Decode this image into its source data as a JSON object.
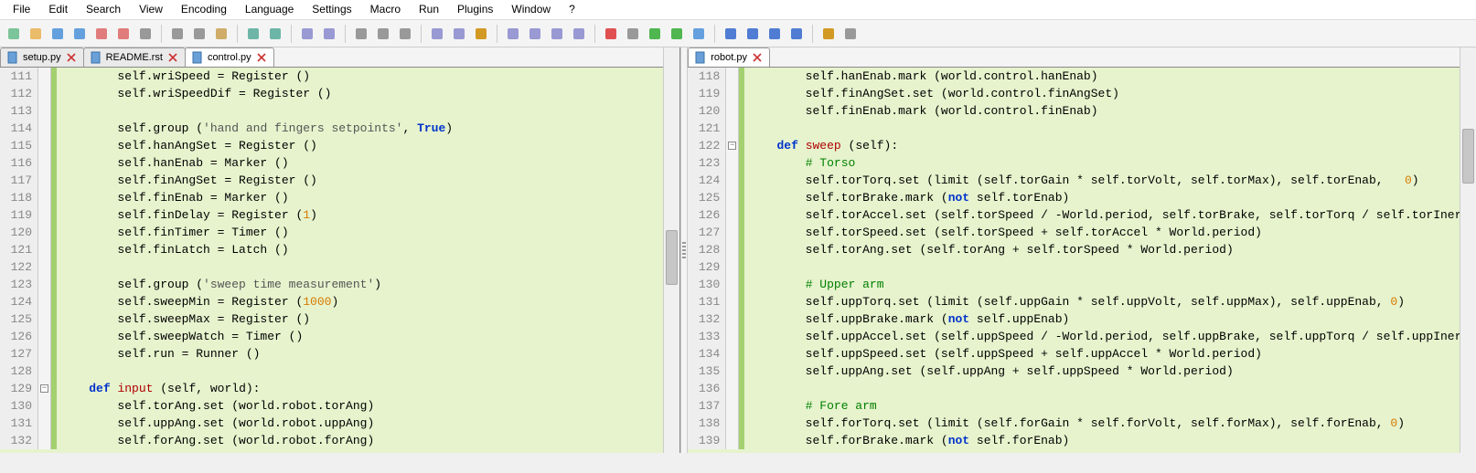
{
  "menu": [
    "File",
    "Edit",
    "Search",
    "View",
    "Encoding",
    "Language",
    "Settings",
    "Macro",
    "Run",
    "Plugins",
    "Window",
    "?"
  ],
  "leftTabs": [
    {
      "label": "setup.py",
      "active": false
    },
    {
      "label": "README.rst",
      "active": false
    },
    {
      "label": "control.py",
      "active": true
    }
  ],
  "rightTabs": [
    {
      "label": "robot.py",
      "active": true
    }
  ],
  "leftLines": [
    {
      "n": 111,
      "segs": [
        {
          "t": "        self.wriSpeed = Register ()"
        }
      ]
    },
    {
      "n": 112,
      "segs": [
        {
          "t": "        self.wriSpeedDif = Register ()"
        }
      ]
    },
    {
      "n": 113,
      "segs": [
        {
          "t": ""
        }
      ]
    },
    {
      "n": 114,
      "segs": [
        {
          "t": "        self.group ("
        },
        {
          "t": "'hand and fingers setpoints'",
          "c": "str"
        },
        {
          "t": ", "
        },
        {
          "t": "True",
          "c": "kw-true"
        },
        {
          "t": ")"
        }
      ]
    },
    {
      "n": 115,
      "segs": [
        {
          "t": "        self.hanAngSet = Register ()"
        }
      ]
    },
    {
      "n": 116,
      "segs": [
        {
          "t": "        self.hanEnab = Marker ()"
        }
      ]
    },
    {
      "n": 117,
      "segs": [
        {
          "t": "        self.finAngSet = Register ()"
        }
      ]
    },
    {
      "n": 118,
      "segs": [
        {
          "t": "        self.finEnab = Marker ()"
        }
      ]
    },
    {
      "n": 119,
      "segs": [
        {
          "t": "        self.finDelay = Register ("
        },
        {
          "t": "1",
          "c": "num"
        },
        {
          "t": ")"
        }
      ]
    },
    {
      "n": 120,
      "segs": [
        {
          "t": "        self.finTimer = Timer ()"
        }
      ]
    },
    {
      "n": 121,
      "segs": [
        {
          "t": "        self.finLatch = Latch ()"
        }
      ]
    },
    {
      "n": 122,
      "segs": [
        {
          "t": ""
        }
      ]
    },
    {
      "n": 123,
      "segs": [
        {
          "t": "        self.group ("
        },
        {
          "t": "'sweep time measurement'",
          "c": "str"
        },
        {
          "t": ")"
        }
      ]
    },
    {
      "n": 124,
      "segs": [
        {
          "t": "        self.sweepMin = Register ("
        },
        {
          "t": "1000",
          "c": "num"
        },
        {
          "t": ")"
        }
      ]
    },
    {
      "n": 125,
      "segs": [
        {
          "t": "        self.sweepMax = Register ()"
        }
      ]
    },
    {
      "n": 126,
      "segs": [
        {
          "t": "        self.sweepWatch = Timer ()"
        }
      ]
    },
    {
      "n": 127,
      "segs": [
        {
          "t": "        self.run = Runner ()"
        }
      ]
    },
    {
      "n": 128,
      "segs": [
        {
          "t": ""
        }
      ]
    },
    {
      "n": 129,
      "fold": "-",
      "segs": [
        {
          "t": "    "
        },
        {
          "t": "def",
          "c": "kw-def"
        },
        {
          "t": " "
        },
        {
          "t": "input",
          "c": "fname"
        },
        {
          "t": " (self, world):"
        }
      ]
    },
    {
      "n": 130,
      "segs": [
        {
          "t": "        self.torAng.set (world.robot.torAng)"
        }
      ]
    },
    {
      "n": 131,
      "segs": [
        {
          "t": "        self.uppAng.set (world.robot.uppAng)"
        }
      ]
    },
    {
      "n": 132,
      "segs": [
        {
          "t": "        self.forAng.set (world.robot.forAng)"
        }
      ]
    }
  ],
  "rightLines": [
    {
      "n": 118,
      "segs": [
        {
          "t": "        self.hanEnab.mark (world.control.hanEnab)"
        }
      ]
    },
    {
      "n": 119,
      "segs": [
        {
          "t": "        self.finAngSet.set (world.control.finAngSet)"
        }
      ]
    },
    {
      "n": 120,
      "segs": [
        {
          "t": "        self.finEnab.mark (world.control.finEnab)"
        }
      ]
    },
    {
      "n": 121,
      "segs": [
        {
          "t": ""
        }
      ]
    },
    {
      "n": 122,
      "fold": "-",
      "segs": [
        {
          "t": "    "
        },
        {
          "t": "def",
          "c": "kw-def"
        },
        {
          "t": " "
        },
        {
          "t": "sweep",
          "c": "fname"
        },
        {
          "t": " (self):"
        }
      ]
    },
    {
      "n": 123,
      "segs": [
        {
          "t": "        "
        },
        {
          "t": "# Torso",
          "c": "cmt"
        }
      ]
    },
    {
      "n": 124,
      "segs": [
        {
          "t": "        self.torTorq.set (limit (self.torGain * self.torVolt, self.torMax), self.torEnab,   "
        },
        {
          "t": "0",
          "c": "num"
        },
        {
          "t": ")"
        }
      ]
    },
    {
      "n": 125,
      "segs": [
        {
          "t": "        self.torBrake.mark ("
        },
        {
          "t": "not",
          "c": "kw-def"
        },
        {
          "t": " self.torEnab)"
        }
      ]
    },
    {
      "n": 126,
      "segs": [
        {
          "t": "        self.torAccel.set (self.torSpeed / -World.period, self.torBrake, self.torTorq / self.torInert)"
        }
      ]
    },
    {
      "n": 127,
      "segs": [
        {
          "t": "        self.torSpeed.set (self.torSpeed + self.torAccel * World.period)"
        }
      ]
    },
    {
      "n": 128,
      "segs": [
        {
          "t": "        self.torAng.set (self.torAng + self.torSpeed * World.period)"
        }
      ]
    },
    {
      "n": 129,
      "segs": [
        {
          "t": ""
        }
      ]
    },
    {
      "n": 130,
      "segs": [
        {
          "t": "        "
        },
        {
          "t": "# Upper arm",
          "c": "cmt"
        }
      ]
    },
    {
      "n": 131,
      "segs": [
        {
          "t": "        self.uppTorq.set (limit (self.uppGain * self.uppVolt, self.uppMax), self.uppEnab, "
        },
        {
          "t": "0",
          "c": "num"
        },
        {
          "t": ")"
        }
      ]
    },
    {
      "n": 132,
      "segs": [
        {
          "t": "        self.uppBrake.mark ("
        },
        {
          "t": "not",
          "c": "kw-def"
        },
        {
          "t": " self.uppEnab)"
        }
      ]
    },
    {
      "n": 133,
      "segs": [
        {
          "t": "        self.uppAccel.set (self.uppSpeed / -World.period, self.uppBrake, self.uppTorq / self.uppInert)"
        }
      ]
    },
    {
      "n": 134,
      "segs": [
        {
          "t": "        self.uppSpeed.set (self.uppSpeed + self.uppAccel * World.period)"
        }
      ]
    },
    {
      "n": 135,
      "segs": [
        {
          "t": "        self.uppAng.set (self.uppAng + self.uppSpeed * World.period)"
        }
      ]
    },
    {
      "n": 136,
      "segs": [
        {
          "t": ""
        }
      ]
    },
    {
      "n": 137,
      "segs": [
        {
          "t": "        "
        },
        {
          "t": "# Fore arm",
          "c": "cmt"
        }
      ]
    },
    {
      "n": 138,
      "segs": [
        {
          "t": "        self.forTorq.set (limit (self.forGain * self.forVolt, self.forMax), self.forEnab, "
        },
        {
          "t": "0",
          "c": "num"
        },
        {
          "t": ")"
        }
      ]
    },
    {
      "n": 139,
      "segs": [
        {
          "t": "        self.forBrake.mark ("
        },
        {
          "t": "not",
          "c": "kw-def"
        },
        {
          "t": " self.forEnab)"
        }
      ]
    }
  ],
  "toolbarIcons": [
    {
      "name": "new-file-icon",
      "c": "#6b8"
    },
    {
      "name": "open-file-icon",
      "c": "#e8b050"
    },
    {
      "name": "save-icon",
      "c": "#4a90d9"
    },
    {
      "name": "save-all-icon",
      "c": "#4a90d9"
    },
    {
      "name": "close-icon",
      "c": "#d66"
    },
    {
      "name": "close-all-icon",
      "c": "#d66"
    },
    {
      "name": "print-icon",
      "c": "#888"
    },
    {
      "sep": true
    },
    {
      "name": "cut-icon",
      "c": "#888"
    },
    {
      "name": "copy-icon",
      "c": "#888"
    },
    {
      "name": "paste-icon",
      "c": "#c8a050"
    },
    {
      "sep": true
    },
    {
      "name": "undo-icon",
      "c": "#5a9"
    },
    {
      "name": "redo-icon",
      "c": "#5a9"
    },
    {
      "sep": true
    },
    {
      "name": "find-icon",
      "c": "#88c"
    },
    {
      "name": "replace-icon",
      "c": "#88c"
    },
    {
      "sep": true
    },
    {
      "name": "zoom-in-icon",
      "c": "#888"
    },
    {
      "name": "zoom-out-icon",
      "c": "#888"
    },
    {
      "name": "sync-scroll-icon",
      "c": "#888"
    },
    {
      "sep": true
    },
    {
      "name": "wordwrap-icon",
      "c": "#88c"
    },
    {
      "name": "show-all-chars-icon",
      "c": "#88c"
    },
    {
      "name": "indent-guide-icon",
      "c": "#c80"
    },
    {
      "sep": true
    },
    {
      "name": "doc-map-icon",
      "c": "#88c"
    },
    {
      "name": "doc-list-icon",
      "c": "#88c"
    },
    {
      "name": "function-list-icon",
      "c": "#88c"
    },
    {
      "name": "folder-workspace-icon",
      "c": "#88c"
    },
    {
      "sep": true
    },
    {
      "name": "record-macro-icon",
      "c": "#d33"
    },
    {
      "name": "stop-macro-icon",
      "c": "#888"
    },
    {
      "name": "play-macro-icon",
      "c": "#3a3"
    },
    {
      "name": "play-multi-icon",
      "c": "#3a3"
    },
    {
      "name": "save-macro-icon",
      "c": "#4a90d9"
    },
    {
      "sep": true
    },
    {
      "name": "compare-icon",
      "c": "#36c"
    },
    {
      "name": "compare-prev-icon",
      "c": "#36c"
    },
    {
      "name": "compare-next-icon",
      "c": "#36c"
    },
    {
      "name": "compare-clear-icon",
      "c": "#36c"
    },
    {
      "sep": true
    },
    {
      "name": "spellcheck-icon",
      "c": "#c80"
    },
    {
      "name": "extra-icon",
      "c": "#888"
    }
  ]
}
